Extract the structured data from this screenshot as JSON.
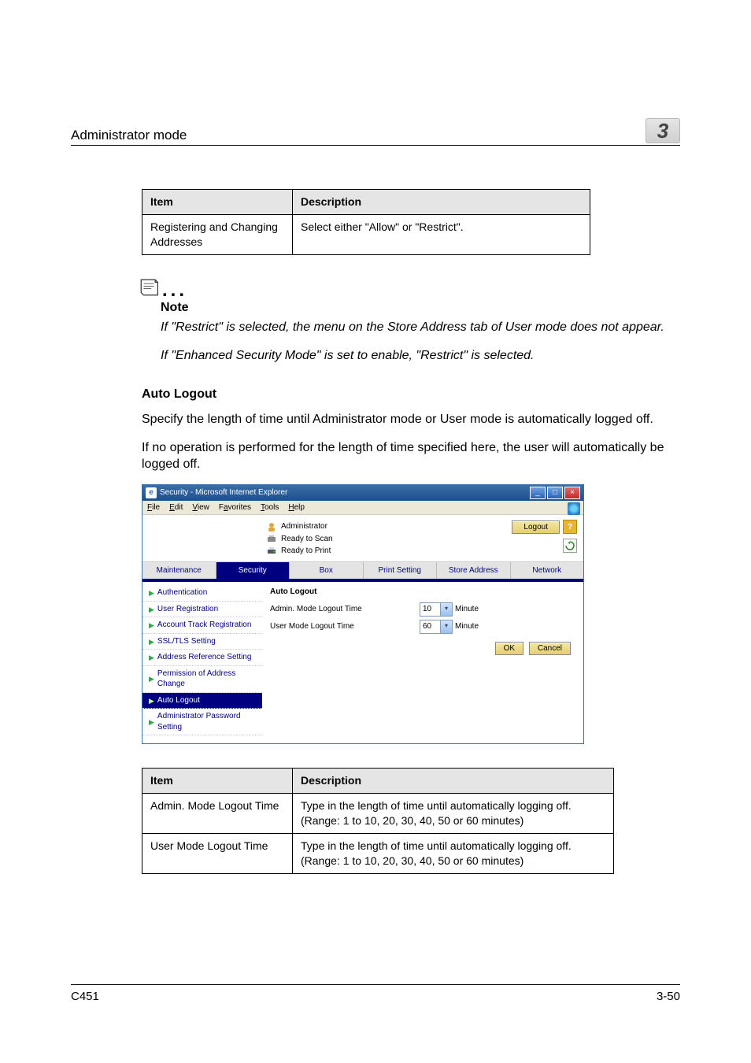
{
  "page": {
    "header_left": "Administrator mode",
    "chapter_number": "3",
    "product": "C451",
    "page_number": "3-50"
  },
  "table1": {
    "columns": [
      "Item",
      "Description"
    ],
    "rows": [
      {
        "item": "Registering and Changing Addresses",
        "desc": "Select either \"Allow\" or \"Restrict\"."
      }
    ]
  },
  "note": {
    "heading": "Note",
    "text1": "If \"Restrict\" is selected, the menu on the Store Address tab of User mode does not appear.",
    "text2": "If \"Enhanced Security Mode\" is set to enable, \"Restrict\" is selected."
  },
  "section": {
    "heading": "Auto Logout",
    "p1": "Specify the length of time until Administrator mode or User mode is automatically logged off.",
    "p2": "If no operation is performed for the length of time specified here, the user will automatically be logged off."
  },
  "screenshot": {
    "window_title": "Security - Microsoft Internet Explorer",
    "menubar": [
      "File",
      "Edit",
      "View",
      "Favorites",
      "Tools",
      "Help"
    ],
    "role": "Administrator",
    "status": {
      "scan": "Ready to Scan",
      "print": "Ready to Print"
    },
    "logout": "Logout",
    "help": "?",
    "tabs": [
      "Maintenance",
      "Security",
      "Box",
      "Print Setting",
      "Store Address",
      "Network"
    ],
    "active_tab_index": 1,
    "sidebar": [
      "Authentication",
      "User Registration",
      "Account Track Registration",
      "SSL/TLS Setting",
      "Address Reference Setting",
      "Permission of Address Change",
      "Auto Logout",
      "Administrator Password Setting"
    ],
    "selected_sidebar_index": 6,
    "main_heading": "Auto Logout",
    "fields": [
      {
        "label": "Admin. Mode Logout Time",
        "value": "10",
        "unit": "Minute"
      },
      {
        "label": "User Mode Logout Time",
        "value": "60",
        "unit": "Minute"
      }
    ],
    "buttons": {
      "ok": "OK",
      "cancel": "Cancel"
    }
  },
  "table2": {
    "columns": [
      "Item",
      "Description"
    ],
    "rows": [
      {
        "item": "Admin. Mode Logout Time",
        "desc": "Type in the length of time until automatically logging off. (Range: 1 to 10, 20, 30, 40, 50 or 60 minutes)"
      },
      {
        "item": "User Mode Logout Time",
        "desc": "Type in the length of time until automatically logging off. (Range: 1 to 10, 20, 30, 40, 50 or 60 minutes)"
      }
    ]
  }
}
